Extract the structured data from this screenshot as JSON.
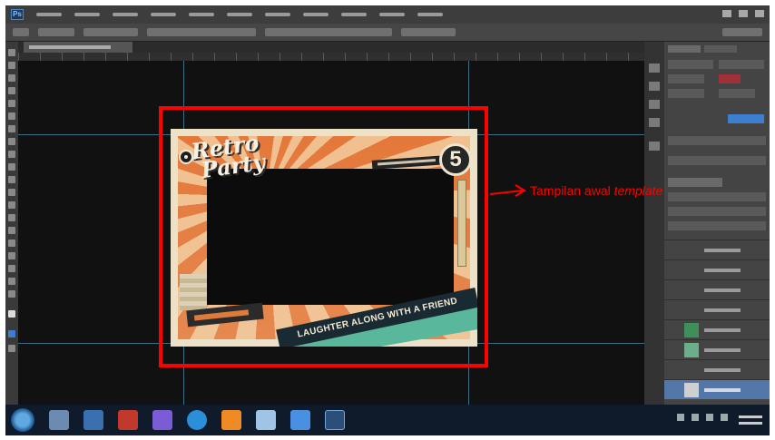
{
  "annotation": {
    "label": "Tampilan awal",
    "label_italic": "template",
    "color": "#ff0000"
  },
  "poster": {
    "title_line1": "Retro",
    "title_line2": "Party",
    "badge_number": "5",
    "banner_text": "LAUGHTER ALONG WITH A FRIEND"
  },
  "app": {
    "logo": "Ps"
  },
  "colors": {
    "highlight_box": "#ff0000",
    "workspace": "#1b1b1b",
    "selected_layer": "#5277a8",
    "poster_orange": "#e4783a",
    "poster_cream": "#ede2c8",
    "poster_mint": "#59b89b"
  }
}
